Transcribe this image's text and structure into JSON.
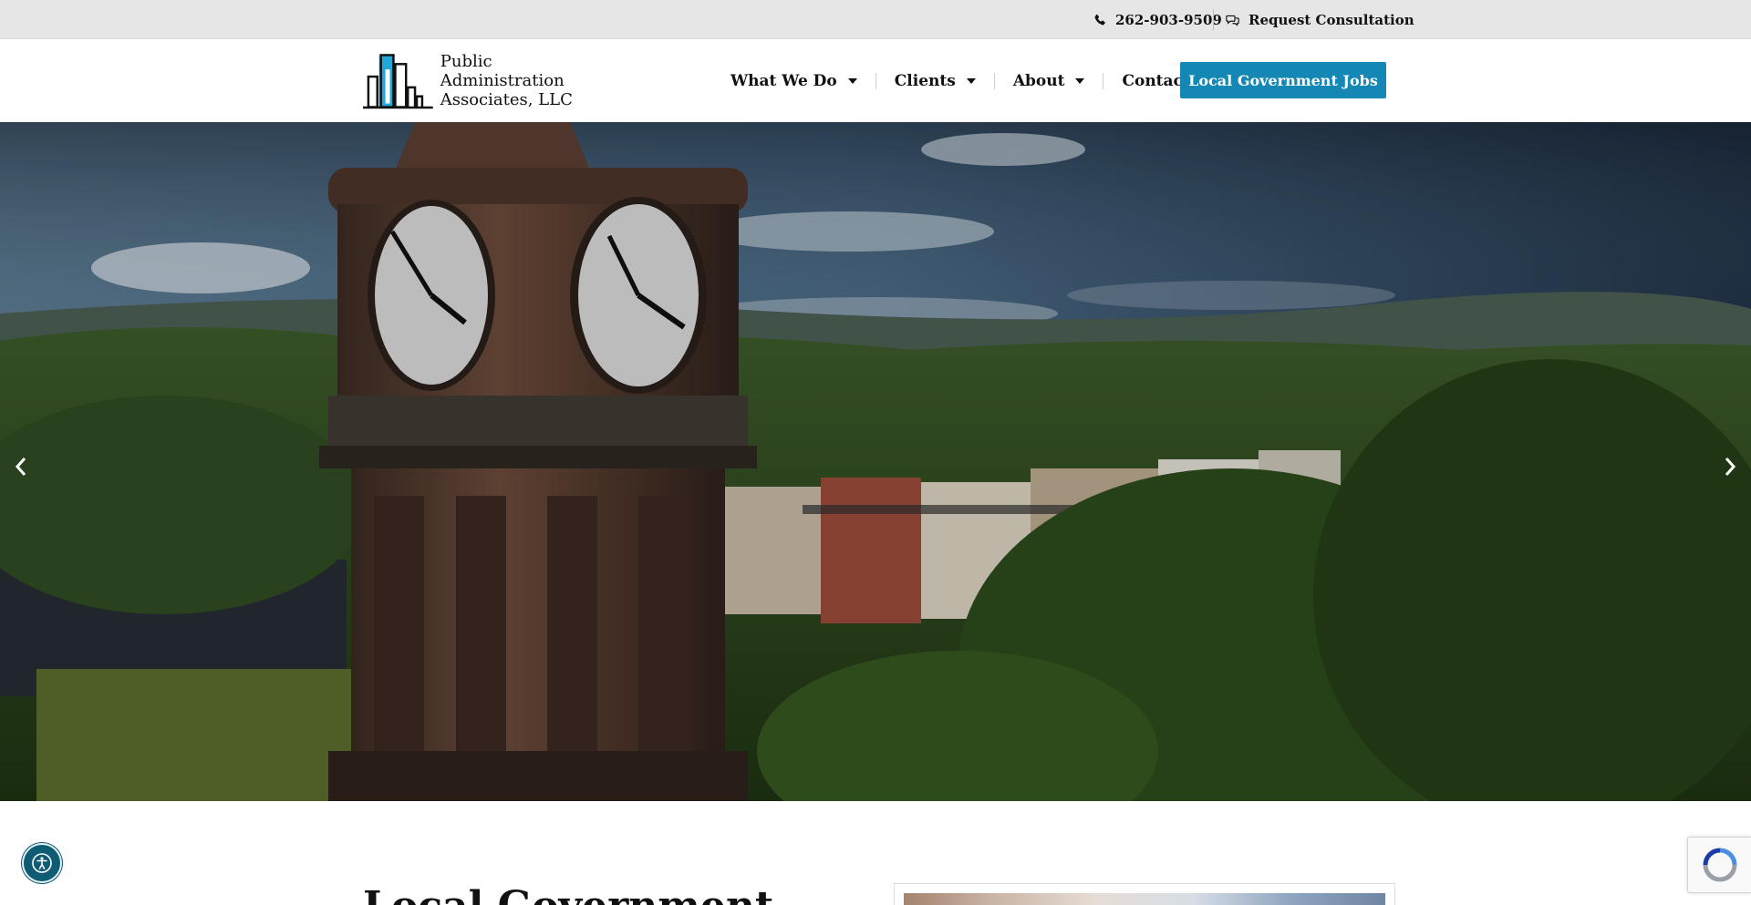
{
  "topbar": {
    "phone": "262-903-9509",
    "consult": "Request Consultation"
  },
  "logo": {
    "line1": "Public Administration",
    "line2": "Associates, LLC"
  },
  "nav": {
    "items": [
      {
        "label": "What We Do",
        "dropdown": true
      },
      {
        "label": "Clients",
        "dropdown": true
      },
      {
        "label": "About",
        "dropdown": true
      },
      {
        "label": "Contact",
        "dropdown": false
      }
    ],
    "cta": "Local Government Jobs"
  },
  "hero": {
    "icons": {
      "prev": "chevron-left-icon",
      "next": "chevron-right-icon"
    }
  },
  "section": {
    "headline": "Local Government"
  },
  "colors": {
    "accent": "#1487b5",
    "topbar_bg": "#e6e6e6",
    "a11y": "#0d5c73"
  }
}
